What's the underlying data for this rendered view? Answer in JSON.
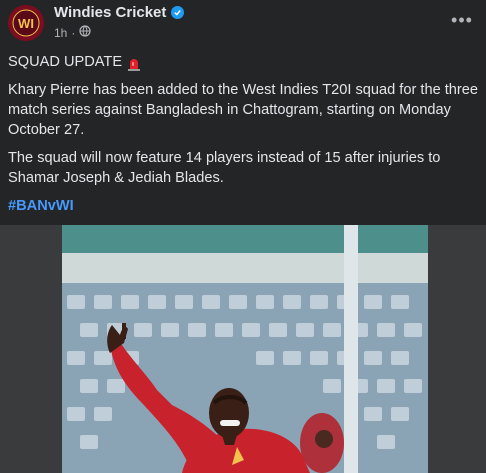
{
  "post": {
    "author": "Windies Cricket",
    "avatar_label": "WI",
    "verified_icon": "verified-badge-icon",
    "timestamp": "1h",
    "separator": "·",
    "audience_icon": "globe-icon",
    "more_label": "•••",
    "heading": "SQUAD UPDATE",
    "paragraph1": "Khary Pierre has been added to the West Indies T20I squad for the three match series against Bangladesh in Chattogram, starting on Monday October 27.",
    "paragraph2": "The squad will now feature 14 players instead of 15 after injuries to Shamar Joseph & Jediah Blades.",
    "hashtag": "#BANvWI"
  },
  "colors": {
    "background": "#242526",
    "text": "#e4e6eb",
    "muted": "#b0b3b8",
    "link": "#4599ff",
    "jersey": "#c8232c"
  }
}
